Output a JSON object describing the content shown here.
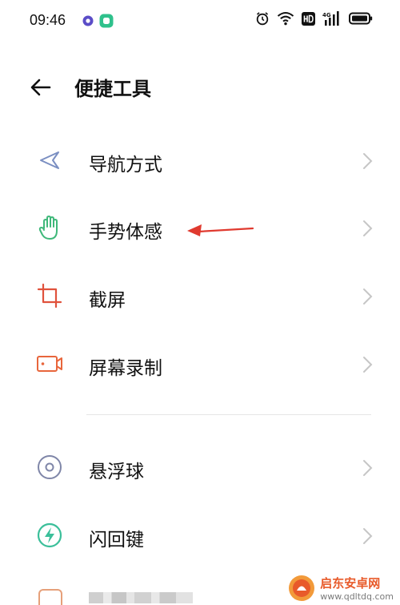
{
  "status_bar": {
    "time": "09:46",
    "app_icons": [
      "record-icon",
      "app-icon"
    ],
    "system_icons": [
      "alarm-icon",
      "wifi-icon",
      "hd-icon",
      "signal-4g-icon",
      "battery-icon"
    ]
  },
  "header": {
    "title": "便捷工具",
    "back_icon": "back-arrow-icon"
  },
  "menu": {
    "group1": [
      {
        "label": "导航方式",
        "icon": "navigation-triangle-icon"
      },
      {
        "label": "手势体感",
        "icon": "hand-gesture-icon"
      },
      {
        "label": "截屏",
        "icon": "crop-screenshot-icon"
      },
      {
        "label": "屏幕录制",
        "icon": "screen-record-icon"
      }
    ],
    "group2": [
      {
        "label": "悬浮球",
        "icon": "floating-ball-icon"
      },
      {
        "label": "闪回键",
        "icon": "flashback-icon"
      }
    ]
  },
  "annotation": {
    "type": "red-arrow",
    "points_to": "手势体感",
    "color": "#e03a2f"
  },
  "watermark": {
    "main": "启东安卓网",
    "sub": "www.qdltdq.com"
  },
  "colors": {
    "nav_icon": "#7b8fc2",
    "hand_icon": "#3fb87a",
    "crop_icon": "#e0523c",
    "record_icon": "#e8663c",
    "ball_icon": "#7f86a8",
    "flash_icon": "#3bbf9a",
    "chevron": "#c6c6c6"
  }
}
